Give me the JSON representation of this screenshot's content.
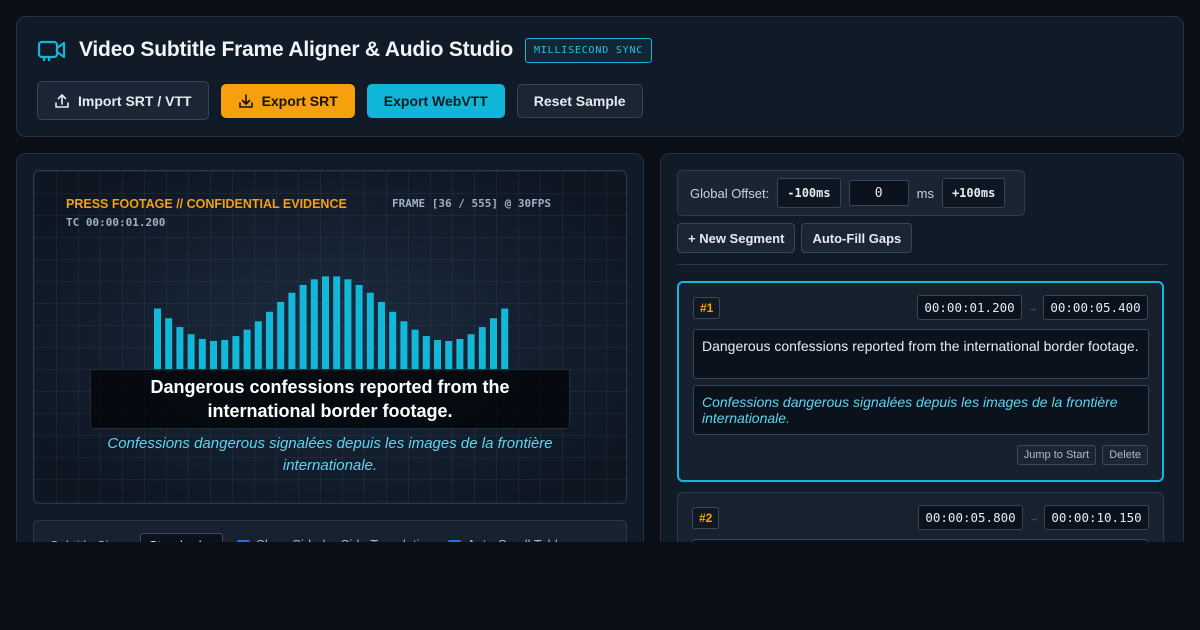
{
  "app": {
    "title": "Video Subtitle Frame Aligner & Audio Studio",
    "badge": "MILLISECOND SYNC",
    "accent": "#13b8d8",
    "warning": "#f5a00c"
  },
  "toolbar": {
    "import_label": "Import SRT / VTT",
    "export_srt_label": "Export SRT",
    "export_vtt_label": "Export WebVTT",
    "reset_label": "Reset Sample"
  },
  "video": {
    "footage_label": "PRESS FOOTAGE // CONFIDENTIAL EVIDENCE",
    "frame_label": "FRAME [36 / 555] @ 30FPS",
    "timecode": "TC 00:00:01.200",
    "subtitle_primary": "Dangerous confessions reported from the international border footage.",
    "subtitle_translation": "Confessions dangerous signalées depuis les images de la frontière internationale."
  },
  "controls": {
    "size_label": "Subtitle Size:",
    "size_value": "Standard",
    "side_by_side_label": "Show Side-by-Side Translation",
    "side_by_side_checked": true,
    "autoscroll_label": "Auto-Scroll Table",
    "autoscroll_checked": true
  },
  "offset": {
    "label": "Global Offset:",
    "minus_label": "-100ms",
    "value": "0",
    "unit": "ms",
    "plus_label": "+100ms"
  },
  "segment_actions": {
    "new_label": "+ New Segment",
    "autofill_label": "Auto-Fill Gaps"
  },
  "segments": [
    {
      "num": "#1",
      "start": "00:00:01.200",
      "end": "00:00:05.400",
      "text": "Dangerous confessions reported from the international border footage.",
      "translation": "Confessions dangerous signalées depuis les images de la frontière internationale.",
      "jump_label": "Jump to Start",
      "delete_label": "Delete"
    },
    {
      "num": "#2",
      "start": "00:00:05.800",
      "end": "00:00:10.150"
    }
  ],
  "icons": {
    "app": "video-camera-icon",
    "import": "upload-icon",
    "export": "download-icon",
    "arrow": "right-arrow-icon"
  }
}
